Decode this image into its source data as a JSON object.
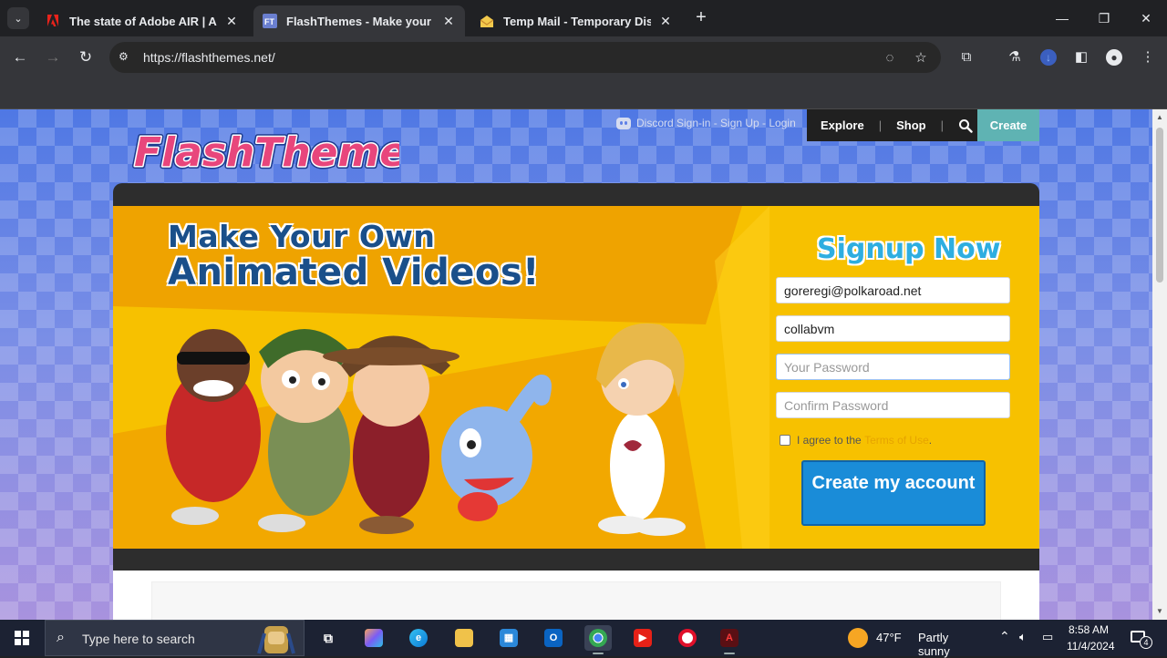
{
  "browser": {
    "tabs": [
      {
        "title": "The state of Adobe AIR | Adob",
        "favicon": "adobe-icon",
        "active": false
      },
      {
        "title": "FlashThemes - Make your own",
        "favicon": "flashthemes-icon",
        "active": true
      },
      {
        "title": "Temp Mail - Temporary Dispo",
        "favicon": "tempmail-icon",
        "active": false
      }
    ],
    "url": "https://flashthemes.net/"
  },
  "site": {
    "logo_text": "FlashThemes",
    "discord_link": "Discord Sign-in - Sign Up - Login",
    "nav": {
      "explore": "Explore",
      "shop": "Shop",
      "create": "Create"
    },
    "hero": {
      "headline_line1": "Make Your Own",
      "headline_line2": "Animated Videos!"
    },
    "signup": {
      "title": "Signup Now",
      "email_value": "goreregi@polkaroad.net",
      "username_value": "collabvm",
      "password_placeholder": "Your Password",
      "confirm_placeholder": "Confirm Password",
      "agree_text": "I agree to the",
      "terms_link": "Terms of Use",
      "agree_suffix": ".",
      "submit_label": "Create my account"
    }
  },
  "taskbar": {
    "search_placeholder": "Type here to search",
    "weather": {
      "temp": "47°F",
      "condition": "Partly sunny"
    },
    "clock": {
      "time": "8:58 AM",
      "date": "11/4/2024"
    },
    "notification_count": "4"
  }
}
